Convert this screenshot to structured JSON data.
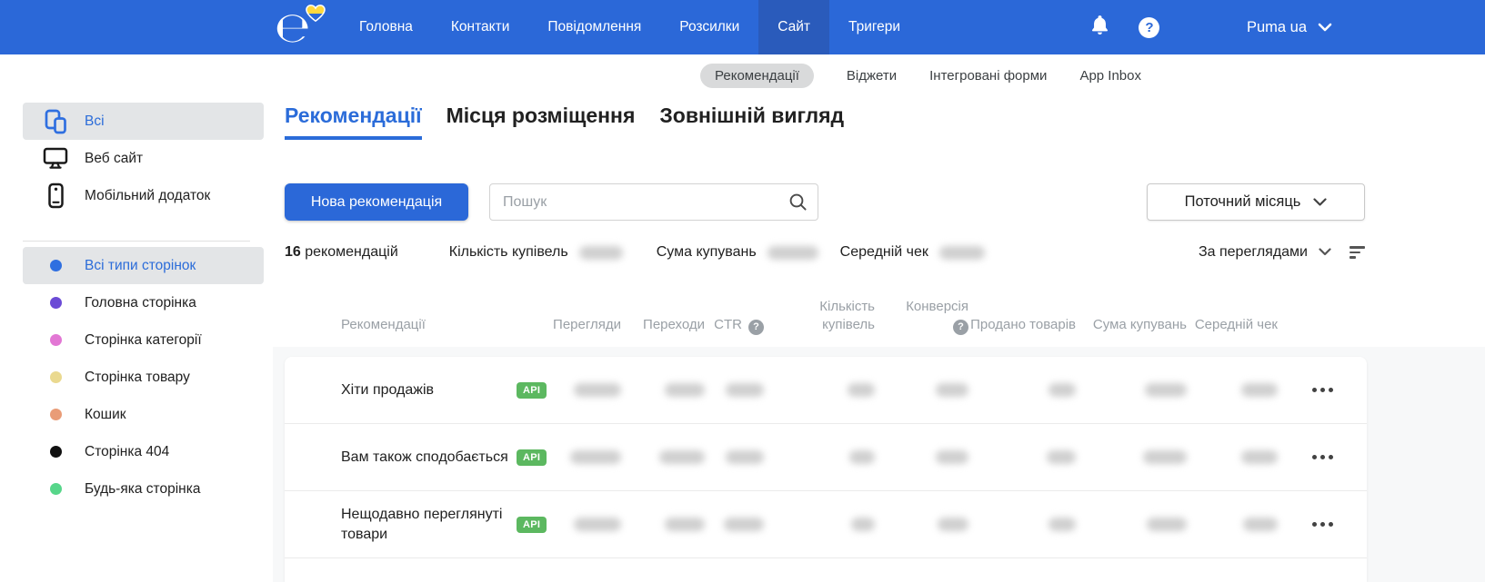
{
  "navbar": {
    "brand": "eSputnik",
    "items": [
      {
        "label": "Головна",
        "active": false
      },
      {
        "label": "Контакти",
        "active": false
      },
      {
        "label": "Повідомлення",
        "active": false
      },
      {
        "label": "Розсилки",
        "active": false
      },
      {
        "label": "Сайт",
        "active": true
      },
      {
        "label": "Тригери",
        "active": false
      }
    ],
    "account_label": "Puma ua"
  },
  "subnav": {
    "items": [
      {
        "label": "Рекомендації",
        "active": true
      },
      {
        "label": "Віджети",
        "active": false
      },
      {
        "label": "Інтегровані форми",
        "active": false
      },
      {
        "label": "App Inbox",
        "active": false
      }
    ]
  },
  "sidebar": {
    "channels": [
      {
        "label": "Всі",
        "icon": "devices-icon",
        "selected": true
      },
      {
        "label": "Веб сайт",
        "icon": "monitor-icon",
        "selected": false
      },
      {
        "label": "Мобільний додаток",
        "icon": "phone-icon",
        "selected": false
      }
    ],
    "page_types": [
      {
        "label": "Всі типи сторінок",
        "color": "#2f6fe0",
        "selected": true
      },
      {
        "label": "Головна сторінка",
        "color": "#6b4bd6",
        "selected": false
      },
      {
        "label": "Сторінка категорії",
        "color": "#e277d4",
        "selected": false
      },
      {
        "label": "Сторінка товару",
        "color": "#ead98f",
        "selected": false
      },
      {
        "label": "Кошик",
        "color": "#e99c77",
        "selected": false
      },
      {
        "label": "Сторінка 404",
        "color": "#111111",
        "selected": false
      },
      {
        "label": "Будь-яка сторінка",
        "color": "#57d68a",
        "selected": false
      }
    ]
  },
  "tabs": [
    {
      "label": "Рекомендації",
      "active": true
    },
    {
      "label": "Місця розміщення",
      "active": false
    },
    {
      "label": "Зовнішній вигляд",
      "active": false
    }
  ],
  "controls": {
    "new_button": "Нова рекомендація",
    "search_placeholder": "Пошук",
    "period_select": "Поточний місяць"
  },
  "stats": {
    "count": "16",
    "count_label": "рекомендацій",
    "metrics": [
      {
        "label": "Кількість купівель",
        "value_redacted": true
      },
      {
        "label": "Сума купувань",
        "value_redacted": true
      },
      {
        "label": "Середній чек",
        "value_redacted": true
      }
    ],
    "sort_label": "За переглядами"
  },
  "table": {
    "columns": [
      "Рекомендації",
      "Перегляди",
      "Переходи",
      "CTR",
      "Кількість купівель",
      "Конверсія",
      "Продано товарів",
      "Сума купувань",
      "Середній чек"
    ],
    "values_redacted": true,
    "rows": [
      {
        "name": "Хіти продажів",
        "badge": "API"
      },
      {
        "name": "Вам також сподобається",
        "badge": "API"
      },
      {
        "name": "Нещодавно переглянуті товари",
        "badge": "API"
      }
    ]
  },
  "colors": {
    "navbar": "#2b68d8",
    "navbar_active": "#2a5bbb",
    "accent": "#2b6cd9",
    "api_badge": "#5cb860",
    "selected_item_bg": "#e3e5e7",
    "table_section_bg": "#f7f8f9",
    "header_text": "#9aa0a6"
  }
}
